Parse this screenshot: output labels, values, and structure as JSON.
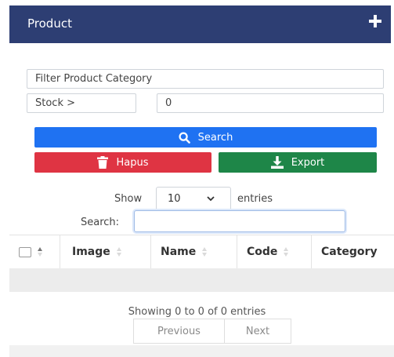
{
  "header": {
    "title": "Product",
    "add_icon": "plus-icon"
  },
  "filters": {
    "category_value": "Filter Product Category",
    "stock_label": "Stock >",
    "stock_value": "0"
  },
  "buttons": {
    "search": {
      "label": "Search",
      "icon": "search-icon",
      "color": "#1f72f2"
    },
    "hapus": {
      "label": "Hapus",
      "icon": "trash-icon",
      "color": "#df3443"
    },
    "export": {
      "label": "Export",
      "icon": "download-icon",
      "color": "#1e8648"
    }
  },
  "length": {
    "show": "Show",
    "selected": "10",
    "entries": "entries"
  },
  "search": {
    "label": "Search:",
    "value": ""
  },
  "table": {
    "columns": [
      "Image",
      "Name",
      "Code",
      "Category"
    ]
  },
  "pagination": {
    "info": "Showing 0 to 0 of 0 entries",
    "previous": "Previous",
    "next": "Next"
  },
  "colors": {
    "header_bg": "#2d3e73"
  }
}
